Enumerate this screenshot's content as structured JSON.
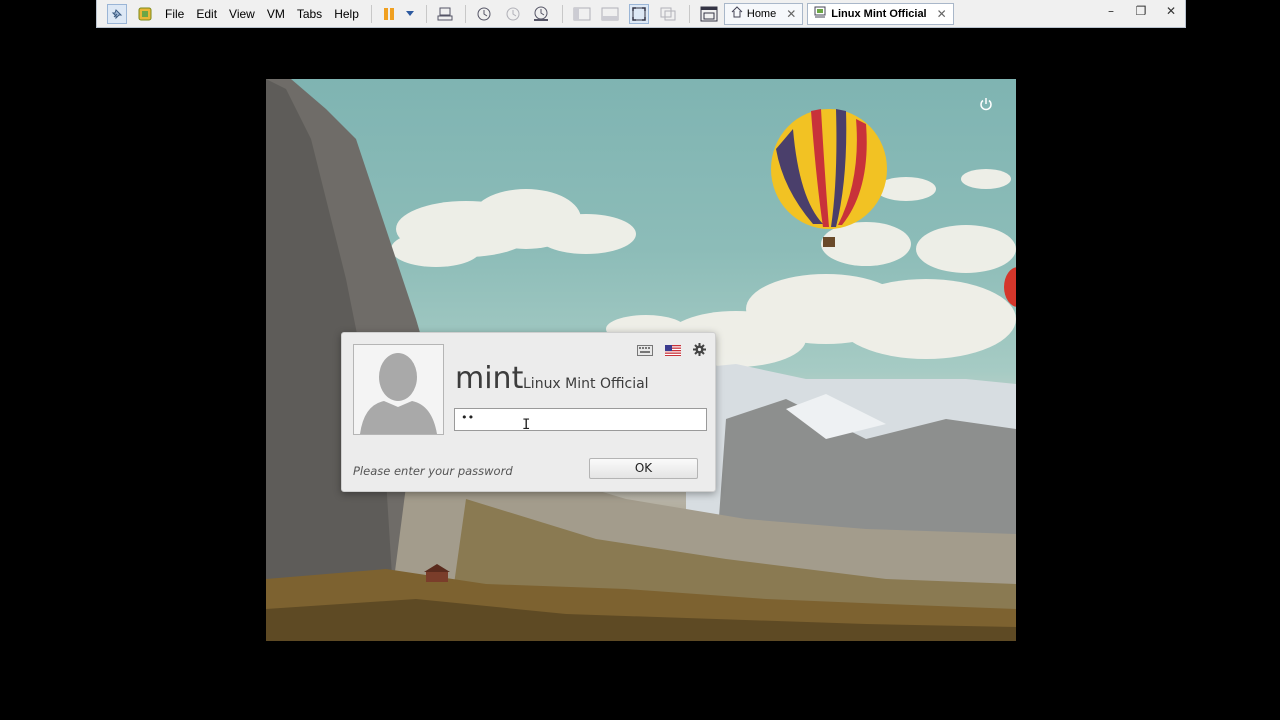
{
  "menu": [
    "File",
    "Edit",
    "View",
    "VM",
    "Tabs",
    "Help"
  ],
  "tabs": [
    {
      "label": "Home",
      "close": "✕"
    },
    {
      "label": "Linux Mint Official",
      "close": "✕"
    }
  ],
  "window_controls": {
    "minimize": "–",
    "restore": "❐",
    "close": "✕"
  },
  "login": {
    "username": "mint",
    "realname": "Linux Mint Official",
    "password_value": "••",
    "cursor": "I",
    "hint": "Please enter your password",
    "ok_label": "OK"
  },
  "colors": {
    "dialog_bg": "#ececec",
    "sky": "#7fb4b2",
    "toolbar_bg": "#f0f0f0"
  },
  "icons": {
    "pin": "pin-icon",
    "vm_logo": "vmware-logo-icon",
    "pause": "pause-icon",
    "send_keys": "send-ctrl-alt-del-icon",
    "snapshot": "snapshot-icon",
    "revert": "revert-snapshot-icon",
    "manage": "snapshot-manager-icon",
    "console": "console-view-icon",
    "fullscreen": "fullscreen-icon",
    "unity": "unity-icon",
    "library": "library-icon",
    "home": "home-icon",
    "vm_tab": "vm-tab-icon",
    "power": "power-icon",
    "keyboard": "keyboard-icon",
    "flag": "us-flag-icon",
    "settings": "gear-icon"
  }
}
